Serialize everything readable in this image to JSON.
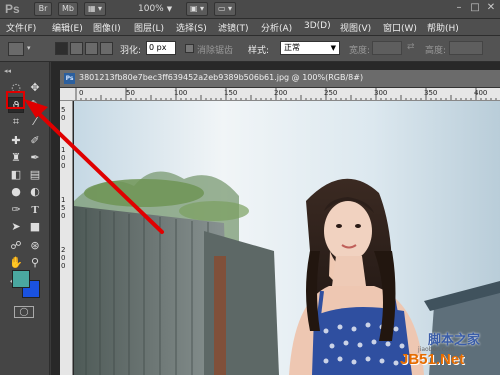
{
  "titlebar": {
    "logo": "Ps",
    "br_label": "Br",
    "mb_label": "Mb",
    "zoom_value": "100%"
  },
  "menu": {
    "items": [
      "文件(F)",
      "编辑(E)",
      "图像(I)",
      "图层(L)",
      "选择(S)",
      "滤镜(T)",
      "分析(A)",
      "3D(D)",
      "视图(V)",
      "窗口(W)",
      "帮助(H)"
    ]
  },
  "options": {
    "feather_label": "羽化:",
    "feather_value": "0 px",
    "antialias_label": "消除锯齿",
    "style_label": "样式:",
    "style_value": "正常",
    "width_label": "宽度:",
    "height_label": "高度:"
  },
  "document": {
    "tab_title": "3801213fb80e7bec3ff639452a2eb9389b506b61.jpg @ 100%(RGB/8#)",
    "ps_badge": "Ps"
  },
  "ruler": {
    "top_ticks": [
      "0",
      "50",
      "100",
      "150",
      "200",
      "250",
      "300",
      "350",
      "400"
    ],
    "left_ticks": [
      "5",
      "0",
      "1",
      "0",
      "0",
      "1",
      "5",
      "0",
      "2",
      "0",
      "0"
    ]
  },
  "swatches": {
    "foreground": "#4aa8a0",
    "background": "#1a52e0"
  },
  "colors": {
    "accent_red": "#e00000",
    "ps_blue": "#2b5f9e"
  },
  "watermark": {
    "logo_text": "脚本之家",
    "sub_text": "jiaoben.com",
    "url_text": "JB51.Net"
  }
}
